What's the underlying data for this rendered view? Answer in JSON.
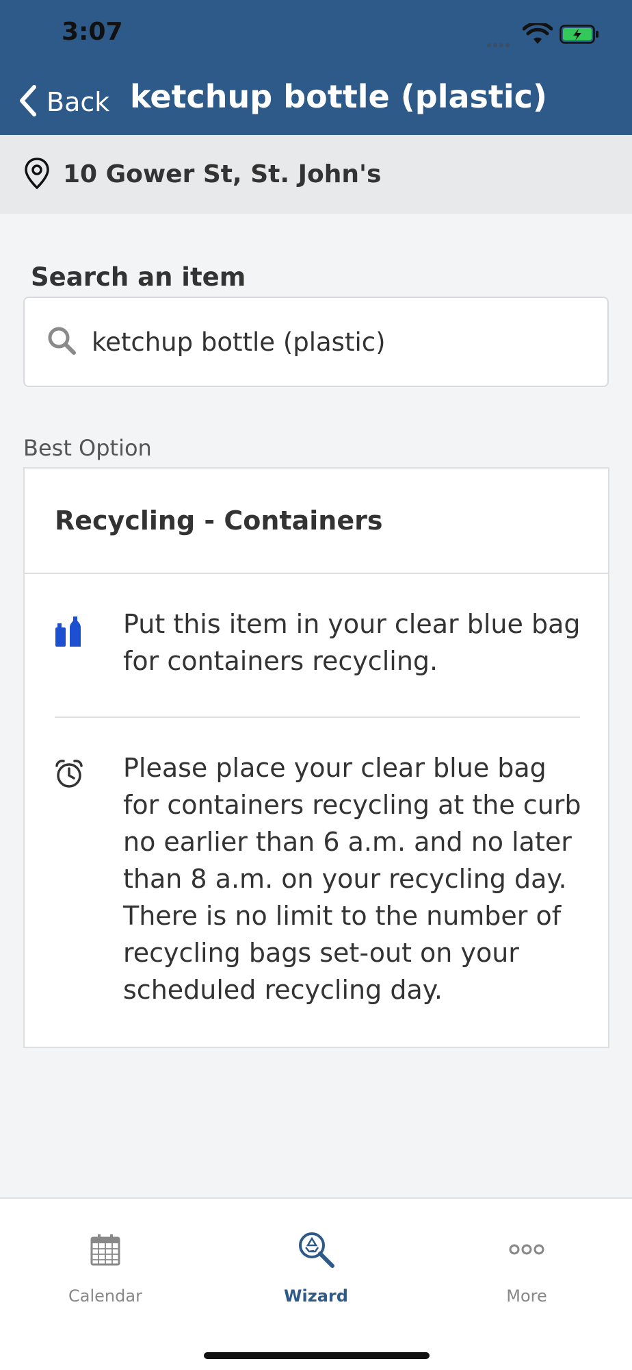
{
  "status_bar": {
    "time": "3:07",
    "icons": [
      "cellular-signal-icon",
      "wifi-icon",
      "battery-charging-icon"
    ]
  },
  "nav": {
    "back_label": "Back",
    "title": "ketchup bottle (plastic)"
  },
  "location": {
    "address": "10 Gower St, St. John's",
    "icon": "location-pin-icon"
  },
  "search": {
    "label": "Search an item",
    "value": "ketchup bottle (plastic)",
    "icon": "search-icon"
  },
  "result": {
    "section_label": "Best Option",
    "title": "Recycling - Containers",
    "instructions": [
      {
        "icon": "bottles-icon",
        "text": "Put this item in your clear blue bag for containers recycling."
      },
      {
        "icon": "alarm-clock-icon",
        "text": "Please place your clear blue bag for containers recycling at the curb no earlier than 6 a.m. and no later than 8 a.m. on your recycling day. There is no limit to the number of recycling bags set-out on your scheduled recycling day."
      }
    ]
  },
  "tabs": [
    {
      "label": "Calendar",
      "icon": "calendar-icon",
      "active": false
    },
    {
      "label": "Wizard",
      "icon": "recycle-search-icon",
      "active": true
    },
    {
      "label": "More",
      "icon": "more-dots-icon",
      "active": false
    }
  ],
  "colors": {
    "header": "#2d5a88",
    "active_tab": "#2d5a88",
    "inactive_tab": "#888888",
    "bottle_icon": "#1f4fd1",
    "battery": "#34c759"
  }
}
